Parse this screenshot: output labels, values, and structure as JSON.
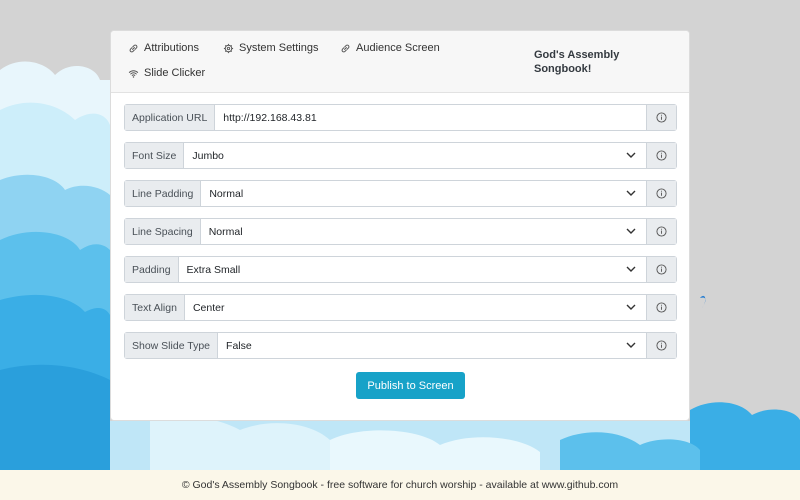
{
  "nav": {
    "attributions": "Attributions",
    "system_settings": "System Settings",
    "audience_screen": "Audience Screen",
    "slide_clicker": "Slide Clicker",
    "brand_line1": "God's Assembly",
    "brand_line2": "Songbook!"
  },
  "form": {
    "application_url": {
      "label": "Application URL",
      "value": "http://192.168.43.81"
    },
    "font_size": {
      "label": "Font Size",
      "value": "Jumbo"
    },
    "line_padding": {
      "label": "Line Padding",
      "value": "Normal"
    },
    "line_spacing": {
      "label": "Line Spacing",
      "value": "Normal"
    },
    "padding": {
      "label": "Padding",
      "value": "Extra Small"
    },
    "text_align": {
      "label": "Text Align",
      "value": "Center"
    },
    "show_slide_type": {
      "label": "Show Slide Type",
      "value": "False"
    },
    "publish_label": "Publish to Screen"
  },
  "footer": {
    "text": "© God's Assembly Songbook - free software for church worship - available at www.github.com"
  },
  "colors": {
    "accent": "#17a2c8",
    "sky": "#bfe6f7",
    "cloud_blue": "#3aaee6",
    "page_bg": "#d3d3d3"
  }
}
